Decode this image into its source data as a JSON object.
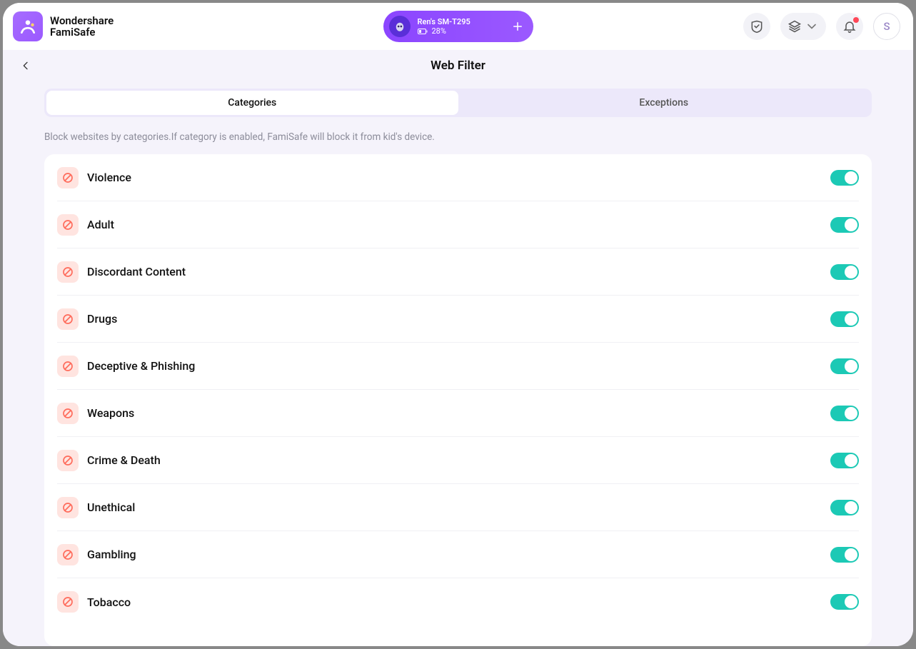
{
  "brand": {
    "line1": "Wondershare",
    "line2": "FamiSafe"
  },
  "device": {
    "name": "Ren's SM-T295",
    "battery": "28%"
  },
  "avatar_initial": "S",
  "page": {
    "title": "Web Filter"
  },
  "tabs": {
    "categories": "Categories",
    "exceptions": "Exceptions"
  },
  "help_text": "Block websites by categories.If category is enabled, FamiSafe will block it from kid's device.",
  "categories": [
    {
      "label": "Violence",
      "enabled": true
    },
    {
      "label": "Adult",
      "enabled": true
    },
    {
      "label": "Discordant Content",
      "enabled": true
    },
    {
      "label": "Drugs",
      "enabled": true
    },
    {
      "label": "Deceptive & Phishing",
      "enabled": true
    },
    {
      "label": "Weapons",
      "enabled": true
    },
    {
      "label": "Crime & Death",
      "enabled": true
    },
    {
      "label": "Unethical",
      "enabled": true
    },
    {
      "label": "Gambling",
      "enabled": true
    },
    {
      "label": "Tobacco",
      "enabled": true
    }
  ]
}
